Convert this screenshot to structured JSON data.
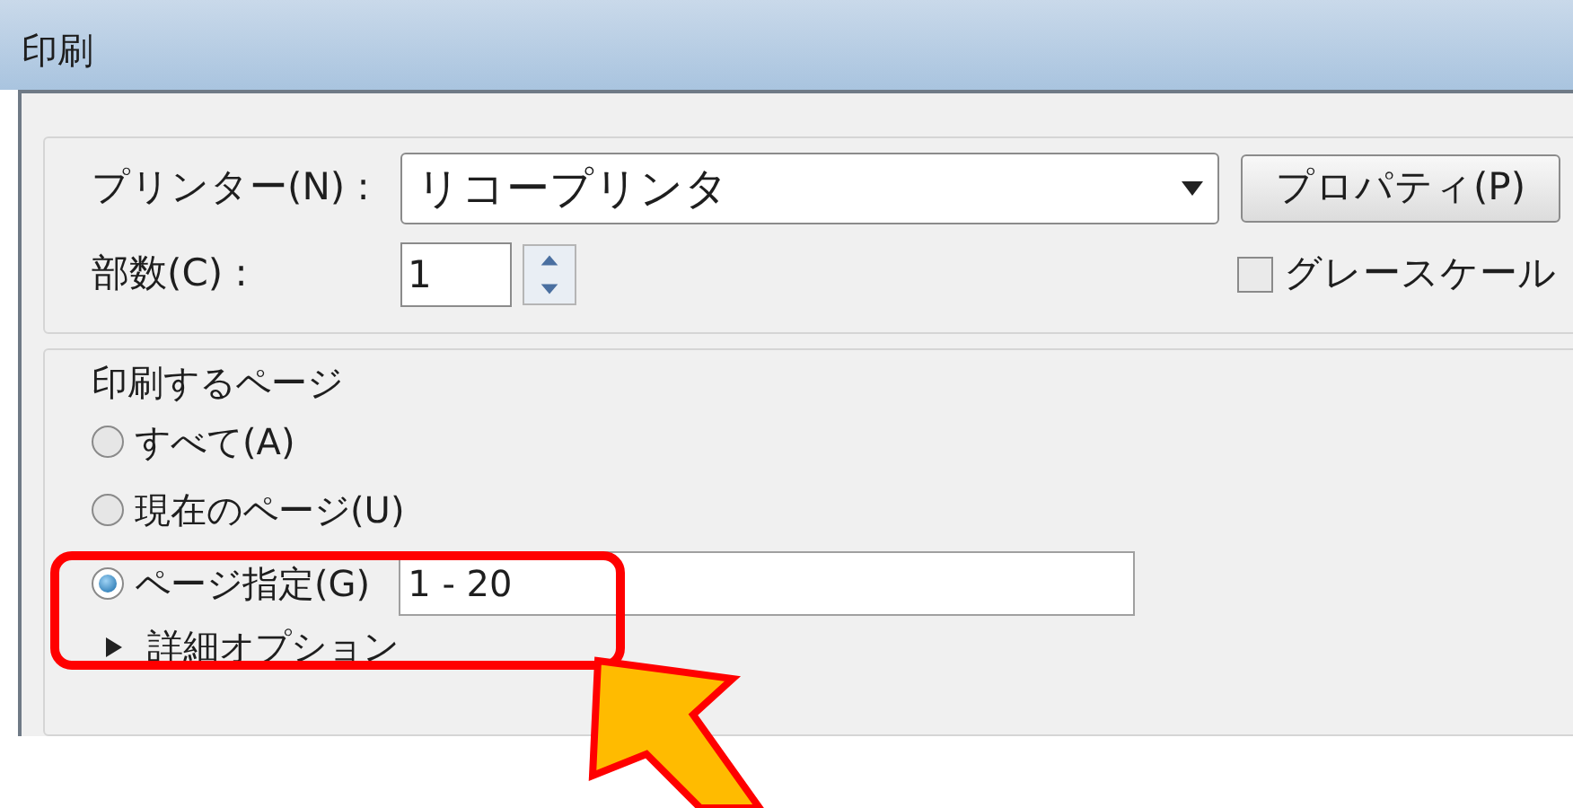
{
  "window": {
    "title": "印刷"
  },
  "printer": {
    "label": "プリンター(N) :",
    "value": "リコープリンタ",
    "properties_button": "プロパティ(P)"
  },
  "copies": {
    "label": "部数(C) :",
    "value": "1"
  },
  "grayscale": {
    "label": "グレースケール",
    "checked": false
  },
  "page_range": {
    "heading": "印刷するページ",
    "options": [
      {
        "label": "すべて(A)",
        "selected": false
      },
      {
        "label": "現在のページ(U)",
        "selected": false
      },
      {
        "label": "ページ指定(G)",
        "selected": true,
        "field_value": "1 - 20"
      }
    ]
  },
  "details": {
    "label": "詳細オプション",
    "expanded": false
  }
}
